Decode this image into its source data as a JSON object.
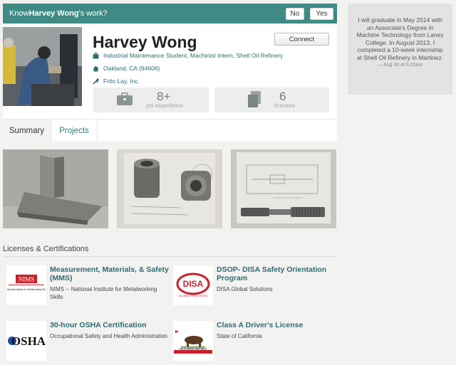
{
  "prompt": {
    "prefix": "Know ",
    "name": "Harvey Wong",
    "suffix": "'s work?",
    "no_label": "No",
    "yes_label": "Yes"
  },
  "profile": {
    "name": "Harvey Wong",
    "connect_label": "Connect",
    "headline": "Industrial Maintenance Student, Machinist Intern, Shell Oil Refinery",
    "location": "Oakland, CA (94606)",
    "company": "Frito Lay, Inc.",
    "stats": [
      {
        "value": "8+",
        "label": "yrs experience",
        "icon": "briefcase-icon"
      },
      {
        "value": "6",
        "label": "licenses",
        "icon": "documents-icon"
      }
    ]
  },
  "tabs": [
    {
      "label": "Summary",
      "active": true
    },
    {
      "label": "Projects",
      "active": false
    }
  ],
  "licenses": {
    "heading": "Licenses & Certifications",
    "items": [
      {
        "name": "Measurement, Materials, & Safety (MMS)",
        "issuer": "NIMS -- National Institute for Metalworking Skills",
        "logo_text": "NIMS",
        "logo_sub": "National Institute for Metalworking Skills"
      },
      {
        "name": "DSOP- DISA Safety Orientation Program",
        "issuer": "DISA Global Solutions",
        "logo_text": "DISA",
        "logo_sub": "GLOBAL SOLUTIONS"
      },
      {
        "name": "30-hour OSHA Certification",
        "issuer": "Occupational Safety and Health Administration",
        "logo_text": "OSHA"
      },
      {
        "name": "Class A Driver's License",
        "issuer": "State of California",
        "logo_text": "CALIFORNIA REPUBLIC"
      }
    ]
  },
  "sidebar": {
    "text": "I will graduate in May 2014 with an Associate's Degree in Machine Technology from Laney College. In August 2013, I completed a 10-week internship at Shell Oil Refinery in Martinez.",
    "time": "— Aug 30 at 6:20am"
  },
  "colors": {
    "accent": "#3f8a84",
    "link": "#2e6b72",
    "page_bg": "#f2f2f0"
  }
}
